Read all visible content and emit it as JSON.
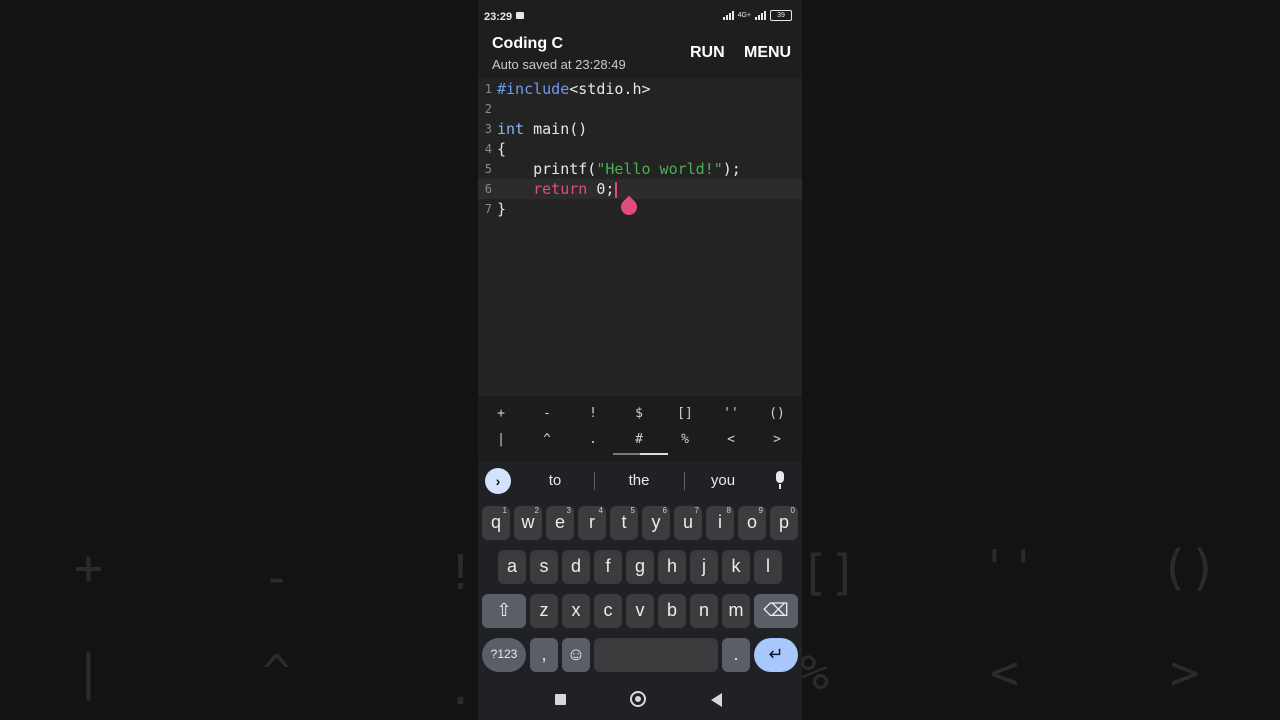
{
  "status": {
    "time": "23:29",
    "network": "4G+",
    "battery": "39"
  },
  "appbar": {
    "title": "Coding C",
    "subtitle": "Auto saved at 23:28:49",
    "run_label": "RUN",
    "menu_label": "MENU"
  },
  "editor": {
    "lines": [
      {
        "num": "1",
        "parts": [
          {
            "t": "#include",
            "c": "kw-pre"
          },
          {
            "t": "<stdio.h>",
            "c": ""
          }
        ]
      },
      {
        "num": "2",
        "parts": []
      },
      {
        "num": "3",
        "parts": [
          {
            "t": "int",
            "c": "kw-int"
          },
          {
            "t": " main()",
            "c": ""
          }
        ]
      },
      {
        "num": "4",
        "parts": [
          {
            "t": "{",
            "c": ""
          }
        ]
      },
      {
        "num": "5",
        "parts": [
          {
            "t": "    printf(",
            "c": ""
          },
          {
            "t": "\"Hello world!\"",
            "c": "str"
          },
          {
            "t": ");",
            "c": ""
          }
        ]
      },
      {
        "num": "6",
        "parts": [
          {
            "t": "    ",
            "c": ""
          },
          {
            "t": "return",
            "c": "kw-ret"
          },
          {
            "t": " 0;",
            "c": ""
          }
        ],
        "active": true,
        "caret": true
      },
      {
        "num": "7",
        "parts": [
          {
            "t": "}",
            "c": ""
          }
        ]
      }
    ]
  },
  "symbols": {
    "row1": [
      "+",
      "-",
      "!",
      "$",
      "[]",
      "''",
      "()"
    ],
    "row2": [
      "|",
      "^",
      ".",
      "#",
      "%",
      "<",
      ">"
    ]
  },
  "keyboard": {
    "suggestions": [
      "to",
      "the",
      "you"
    ],
    "row1": [
      {
        "k": "q",
        "h": "1"
      },
      {
        "k": "w",
        "h": "2"
      },
      {
        "k": "e",
        "h": "3"
      },
      {
        "k": "r",
        "h": "4"
      },
      {
        "k": "t",
        "h": "5"
      },
      {
        "k": "y",
        "h": "6"
      },
      {
        "k": "u",
        "h": "7"
      },
      {
        "k": "i",
        "h": "8"
      },
      {
        "k": "o",
        "h": "9"
      },
      {
        "k": "p",
        "h": "0"
      }
    ],
    "row2": [
      "a",
      "s",
      "d",
      "f",
      "g",
      "h",
      "j",
      "k",
      "l"
    ],
    "row3": [
      "z",
      "x",
      "c",
      "v",
      "b",
      "n",
      "m"
    ],
    "sym_label": "?123",
    "comma": ",",
    "period": "."
  },
  "background_keys": [
    "+",
    "-",
    "!",
    "[]",
    "''",
    "()",
    "|",
    "^",
    ".",
    "%",
    "<",
    ">"
  ],
  "colors": {
    "accent": "#e34b7f",
    "string": "#4caf50",
    "preprocessor": "#6c9bf2",
    "enter": "#a8c7fa"
  }
}
